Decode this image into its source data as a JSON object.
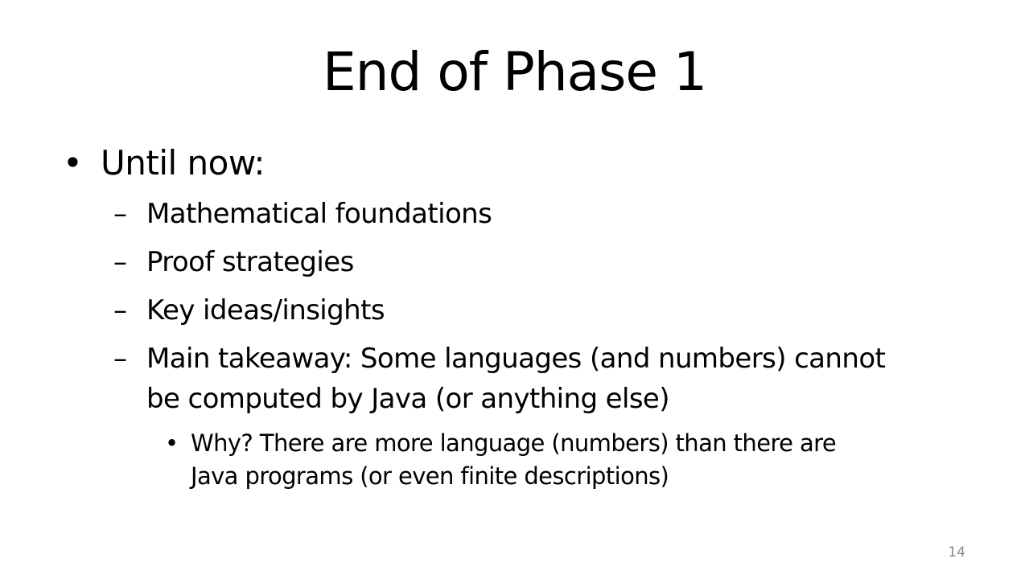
{
  "slide": {
    "title": "End of Phase 1",
    "bullet": {
      "marker": "•",
      "text": "Until now:",
      "sub_marker": "–",
      "sub_items": [
        "Mathematical foundations",
        "Proof strategies",
        "Key ideas/insights",
        "Main takeaway: Some languages (and numbers) cannot"
      ],
      "sub_item_4_continuation": "be computed by Java (or anything else)",
      "nested": {
        "marker": "•",
        "line1": "Why? There are more language (numbers) than there are",
        "line2": "Java programs (or even finite descriptions)"
      }
    },
    "page_number": "14"
  }
}
